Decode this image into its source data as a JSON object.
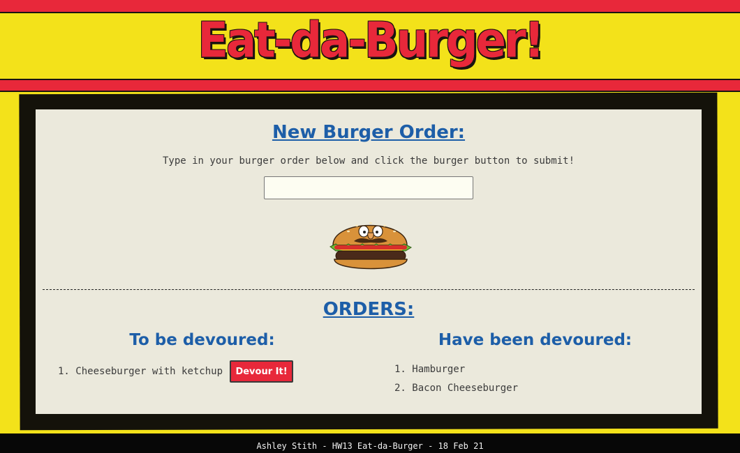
{
  "header": {
    "title": "Eat-da-Burger!"
  },
  "new_order": {
    "heading": "New Burger Order:",
    "instructions": "Type in your burger order below and click the burger button to submit!",
    "input_value": "",
    "input_placeholder": "",
    "submit_icon": "burger-icon"
  },
  "orders": {
    "heading": "ORDERS:",
    "to_be_devoured": {
      "heading": "To be devoured:",
      "items": [
        {
          "number": "1.",
          "name": "Cheeseburger with ketchup",
          "button_label": "Devour It!"
        }
      ]
    },
    "devoured": {
      "heading": "Have been devoured:",
      "items": [
        {
          "number": "1.",
          "name": "Hamburger"
        },
        {
          "number": "2.",
          "name": "Bacon Cheeseburger"
        }
      ]
    }
  },
  "footer": {
    "text": "Ashley Stith - HW13 Eat-da-Burger - 18 Feb 21"
  },
  "colors": {
    "background_yellow": "#f3e21a",
    "accent_red": "#e8283a",
    "heading_blue": "#1d5ea8",
    "panel_bg": "#ebe9dc",
    "frame_black": "#14120a"
  }
}
